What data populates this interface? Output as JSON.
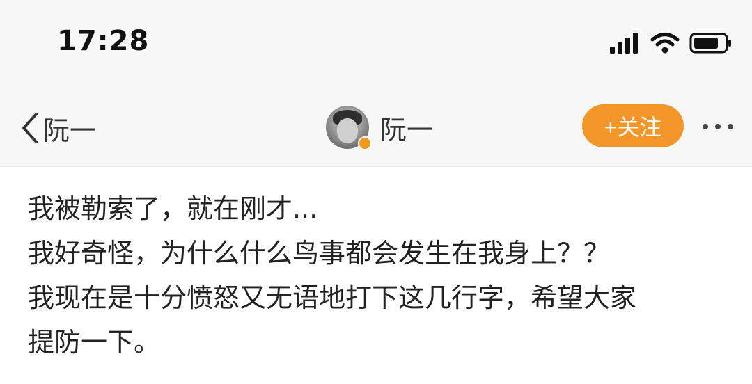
{
  "status_bar": {
    "time": "17:28",
    "icons": [
      "signal-icon",
      "wifi-icon",
      "battery-icon"
    ]
  },
  "nav": {
    "back_label": "阮一",
    "profile_name": "阮一",
    "follow_label": "+关注",
    "icons": [
      "back-chevron-icon",
      "avatar",
      "verified-badge-icon",
      "more-icon"
    ]
  },
  "post": {
    "lines": [
      "我被勒索了，就在刚才...",
      "我好奇怪，为什么什么鸟事都会发生在我身上？？",
      "我现在是十分愤怒又无语地打下这几行字，希望大家",
      "提防一下。"
    ]
  },
  "colors": {
    "follow_button": "#f3962a",
    "verified_badge": "#f29a1b",
    "header_background": "#f7f7f7",
    "text": "#222222"
  }
}
